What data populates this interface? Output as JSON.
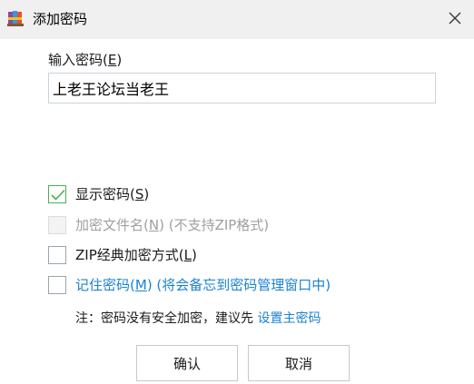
{
  "window": {
    "title": "添加密码",
    "close_icon": "close-icon",
    "app_icon": "winrar-books-icon"
  },
  "password": {
    "label_prefix": "输入密码(",
    "label_key": "E",
    "label_suffix": ")",
    "value": "上老王论坛当老王"
  },
  "options": [
    {
      "text_prefix": "显示密码(",
      "key": "S",
      "text_suffix": ")",
      "checked": true,
      "disabled": false
    },
    {
      "text_prefix": "加密文件名(",
      "key": "N",
      "text_suffix": ") (不支持ZIP格式)",
      "checked": false,
      "disabled": true
    },
    {
      "text_prefix": "ZIP经典加密方式(",
      "key": "L",
      "text_suffix": ")",
      "checked": false,
      "disabled": false
    },
    {
      "text_prefix": "记住密码(",
      "key": "M",
      "text_suffix": ") (将会备忘到密码管理窗口中)",
      "checked": false,
      "disabled": false
    }
  ],
  "note": {
    "text": "注：密码没有安全加密，建议先 ",
    "link": "设置主密码"
  },
  "buttons": {
    "ok": "确认",
    "cancel": "取消"
  },
  "colors": {
    "link": "#1b82d1",
    "check": "#4caf50",
    "titlebar": "#f0f0f0"
  }
}
